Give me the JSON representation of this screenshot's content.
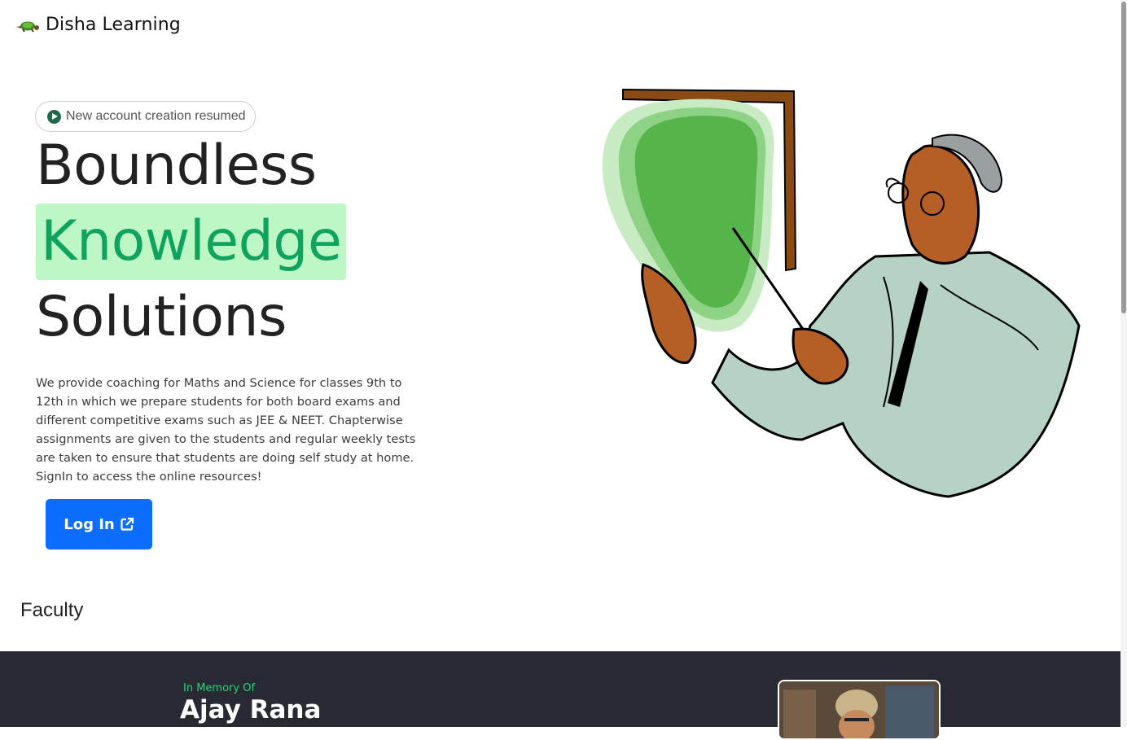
{
  "brand": {
    "name": "Disha Learning",
    "logo_icon": "turtle-logo-icon"
  },
  "hero": {
    "notice": "New account creation resumed",
    "notice_icon": "play-circle-icon",
    "headline_line1": "Boundless",
    "headline_line2": "Knowledge",
    "headline_line3": "Solutions",
    "description": "We provide coaching for Maths and Science for classes 9th to 12th in which we prepare students for both board exams and different competitive exams such as JEE & NEET. Chapterwise assignments are given to the students and regular weekly tests are taken to ensure that students are doing self study at home. SignIn to access the online resources!",
    "login_label": "Log In",
    "login_icon": "external-link-icon",
    "highlight_color": "#bdf7c5",
    "accent_color": "#0fa35e",
    "button_color": "#0d6efd"
  },
  "faculty": {
    "heading": "Faculty",
    "memory_prefix": "In Memory Of",
    "memory_name": "Ajay Rana",
    "section_bg": "#272a33"
  }
}
